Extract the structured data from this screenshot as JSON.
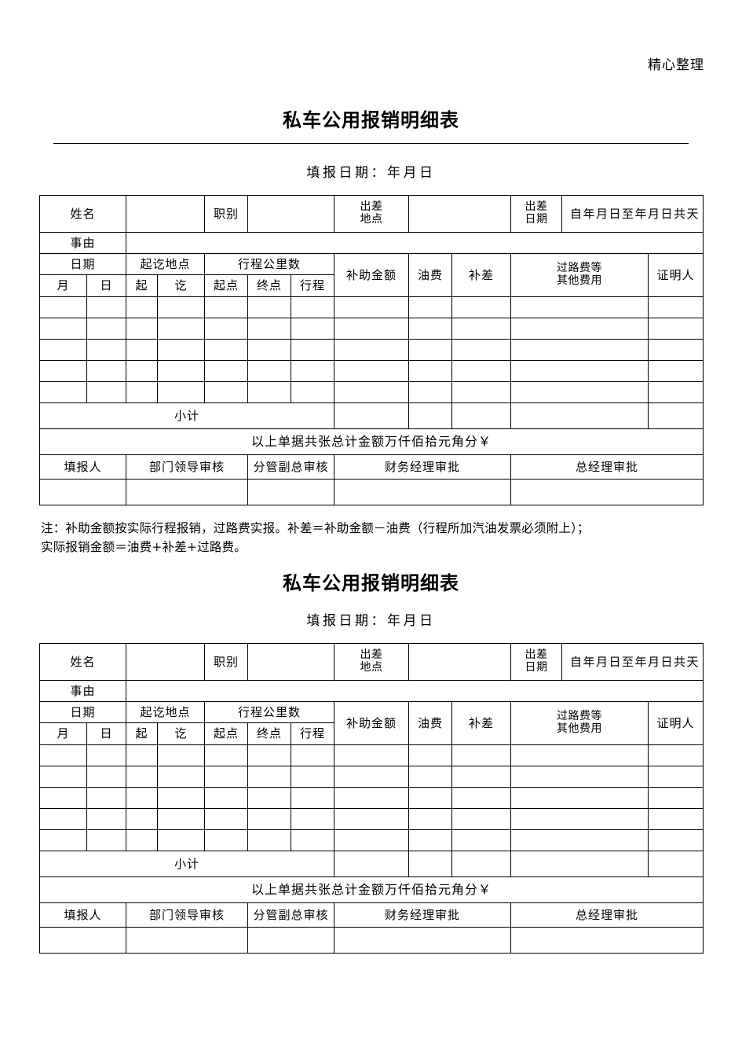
{
  "running_header": "精心整理",
  "form": {
    "title": "私车公用报销明细表",
    "fill_date_label": "填报日期：年月日",
    "info_row": {
      "name_label": "姓名",
      "name_value": "",
      "position_label": "职别",
      "position_value": "",
      "trip_place_label": "出差\n地点",
      "trip_place_label_line1": "出差",
      "trip_place_label_line2": "地点",
      "trip_place_value": "",
      "trip_date_label_line1": "出差",
      "trip_date_label_line2": "日期",
      "trip_date_value": "自年月日至年月日共天"
    },
    "reason_row": {
      "label": "事由",
      "value": ""
    },
    "table_headers": {
      "group_date": "日期",
      "group_place": "起讫地点",
      "group_distance": "行程公里数",
      "sub_month": "月",
      "sub_day": "日",
      "sub_from": "起",
      "sub_to": "讫",
      "sub_start_km": "起点",
      "sub_end_km": "终点",
      "sub_trip_km": "行程",
      "subsidy_amount": "补助金额",
      "fuel_cost": "油费",
      "difference": "补差",
      "toll_other_line1": "过路费等",
      "toll_other_line2": "其他费用",
      "witness": "证明人"
    },
    "data_rows": [
      [
        "",
        "",
        "",
        "",
        "",
        "",
        "",
        "",
        "",
        "",
        "",
        ""
      ],
      [
        "",
        "",
        "",
        "",
        "",
        "",
        "",
        "",
        "",
        "",
        "",
        ""
      ],
      [
        "",
        "",
        "",
        "",
        "",
        "",
        "",
        "",
        "",
        "",
        "",
        ""
      ],
      [
        "",
        "",
        "",
        "",
        "",
        "",
        "",
        "",
        "",
        "",
        "",
        ""
      ],
      [
        "",
        "",
        "",
        "",
        "",
        "",
        "",
        "",
        "",
        "",
        "",
        ""
      ]
    ],
    "subtotal_label": "小计",
    "subtotal_values": [
      "",
      "",
      "",
      "",
      ""
    ],
    "summary_text": "以上单据共张总计金额万仟佰拾元角分￥",
    "signature_labels": [
      "填报人",
      "部门领导审核",
      "分管副总审核",
      "财务经理审批",
      "总经理审批"
    ],
    "signature_values": [
      "",
      "",
      "",
      "",
      ""
    ]
  },
  "note": {
    "line1": "注：补助金额按实际行程报销，过路费实报。补差＝补助金额－油费（行程所加汽油发票必须附上）；",
    "line2": "实际报销金额＝油费+补差+过路费。"
  }
}
